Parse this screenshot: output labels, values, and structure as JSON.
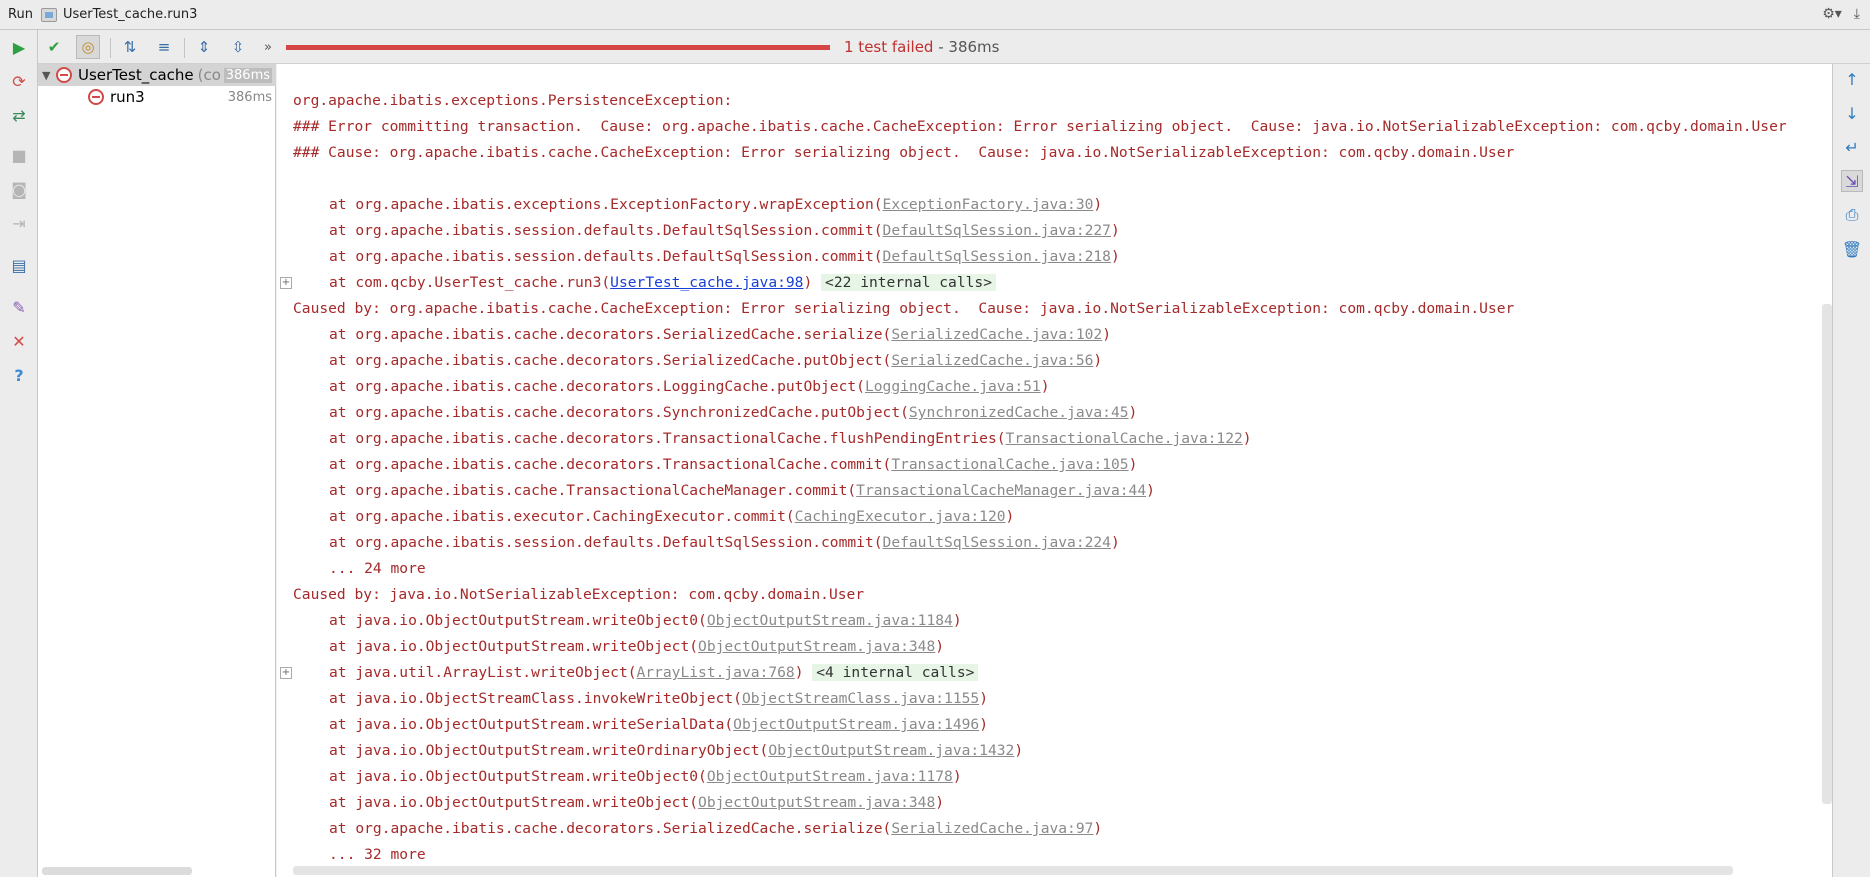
{
  "window": {
    "run_label": "Run",
    "config_title": "UserTest_cache.run3"
  },
  "toolbar": {
    "progress_failed_fraction": 1.0,
    "status_failed": "1 test failed",
    "status_time": " - 386ms",
    "accent_fail": "#d64545"
  },
  "tree": {
    "root": {
      "name": "UserTest_cache",
      "extra": "(co",
      "time": "386ms"
    },
    "child": {
      "name": "run3",
      "time": "386ms"
    }
  },
  "console": {
    "l01": "org.apache.ibatis.exceptions.PersistenceException: ",
    "l02": "### Error committing transaction.  Cause: org.apache.ibatis.cache.CacheException: Error serializing object.  Cause: java.io.NotSerializableException: com.qcby.domain.User",
    "l03": "### Cause: org.apache.ibatis.cache.CacheException: Error serializing object.  Cause: java.io.NotSerializableException: com.qcby.domain.User",
    "l05": {
      "pre": "at org.apache.ibatis.exceptions.ExceptionFactory.wrapException(",
      "link": "ExceptionFactory.java:30",
      "post": ")"
    },
    "l06": {
      "pre": "at org.apache.ibatis.session.defaults.DefaultSqlSession.commit(",
      "link": "DefaultSqlSession.java:227",
      "post": ")"
    },
    "l07": {
      "pre": "at org.apache.ibatis.session.defaults.DefaultSqlSession.commit(",
      "link": "DefaultSqlSession.java:218",
      "post": ")"
    },
    "l08": {
      "pre": "at com.qcby.UserTest_cache.run3(",
      "link": "UserTest_cache.java:98",
      "post": ") ",
      "internal": "<22 internal calls>"
    },
    "l09": "Caused by: org.apache.ibatis.cache.CacheException: Error serializing object.  Cause: java.io.NotSerializableException: com.qcby.domain.User",
    "l10": {
      "pre": "at org.apache.ibatis.cache.decorators.SerializedCache.serialize(",
      "link": "SerializedCache.java:102",
      "post": ")"
    },
    "l11": {
      "pre": "at org.apache.ibatis.cache.decorators.SerializedCache.putObject(",
      "link": "SerializedCache.java:56",
      "post": ")"
    },
    "l12": {
      "pre": "at org.apache.ibatis.cache.decorators.LoggingCache.putObject(",
      "link": "LoggingCache.java:51",
      "post": ")"
    },
    "l13": {
      "pre": "at org.apache.ibatis.cache.decorators.SynchronizedCache.putObject(",
      "link": "SynchronizedCache.java:45",
      "post": ")"
    },
    "l14": {
      "pre": "at org.apache.ibatis.cache.decorators.TransactionalCache.flushPendingEntries(",
      "link": "TransactionalCache.java:122",
      "post": ")"
    },
    "l15": {
      "pre": "at org.apache.ibatis.cache.decorators.TransactionalCache.commit(",
      "link": "TransactionalCache.java:105",
      "post": ")"
    },
    "l16": {
      "pre": "at org.apache.ibatis.cache.TransactionalCacheManager.commit(",
      "link": "TransactionalCacheManager.java:44",
      "post": ")"
    },
    "l17": {
      "pre": "at org.apache.ibatis.executor.CachingExecutor.commit(",
      "link": "CachingExecutor.java:120",
      "post": ")"
    },
    "l18": {
      "pre": "at org.apache.ibatis.session.defaults.DefaultSqlSession.commit(",
      "link": "DefaultSqlSession.java:224",
      "post": ")"
    },
    "l19": "... 24 more",
    "l20": "Caused by: java.io.NotSerializableException: com.qcby.domain.User",
    "l21": {
      "pre": "at java.io.ObjectOutputStream.writeObject0(",
      "link": "ObjectOutputStream.java:1184",
      "post": ")"
    },
    "l22": {
      "pre": "at java.io.ObjectOutputStream.writeObject(",
      "link": "ObjectOutputStream.java:348",
      "post": ")"
    },
    "l23": {
      "pre": "at java.util.ArrayList.writeObject(",
      "link": "ArrayList.java:768",
      "post": ") ",
      "internal": "<4 internal calls>"
    },
    "l24": {
      "pre": "at java.io.ObjectStreamClass.invokeWriteObject(",
      "link": "ObjectStreamClass.java:1155",
      "post": ")"
    },
    "l25": {
      "pre": "at java.io.ObjectOutputStream.writeSerialData(",
      "link": "ObjectOutputStream.java:1496",
      "post": ")"
    },
    "l26": {
      "pre": "at java.io.ObjectOutputStream.writeOrdinaryObject(",
      "link": "ObjectOutputStream.java:1432",
      "post": ")"
    },
    "l27": {
      "pre": "at java.io.ObjectOutputStream.writeObject0(",
      "link": "ObjectOutputStream.java:1178",
      "post": ")"
    },
    "l28": {
      "pre": "at java.io.ObjectOutputStream.writeObject(",
      "link": "ObjectOutputStream.java:348",
      "post": ")"
    },
    "l29": {
      "pre": "at org.apache.ibatis.cache.decorators.SerializedCache.serialize(",
      "link": "SerializedCache.java:97",
      "post": ")"
    },
    "l30": "... 32 more"
  },
  "icons": {
    "rerun": "play-icon",
    "rerun_failed": "rerun-failed-icon",
    "toggle_auto": "toggle-auto-test-icon",
    "stop": "stop-icon",
    "dump": "camera-icon",
    "exit": "exit-icon",
    "layout": "layout-icon",
    "pin": "pin-icon",
    "close": "close-icon",
    "help": "help-icon",
    "show_passed": "show-passed-icon",
    "show_ignored": "show-ignored-icon",
    "sort_alpha": "sort-alpha-icon",
    "sort_duration": "sort-duration-icon",
    "expand_all": "expand-all-icon",
    "collapse_all": "collapse-all-icon",
    "more": "more-icon",
    "up": "up-arrow-icon",
    "down": "down-arrow-icon",
    "soft_wrap": "soft-wrap-icon",
    "scroll_end": "scroll-to-end-icon",
    "print": "print-icon",
    "trash": "trash-icon",
    "gear": "gear-icon",
    "hide": "hide-icon"
  }
}
